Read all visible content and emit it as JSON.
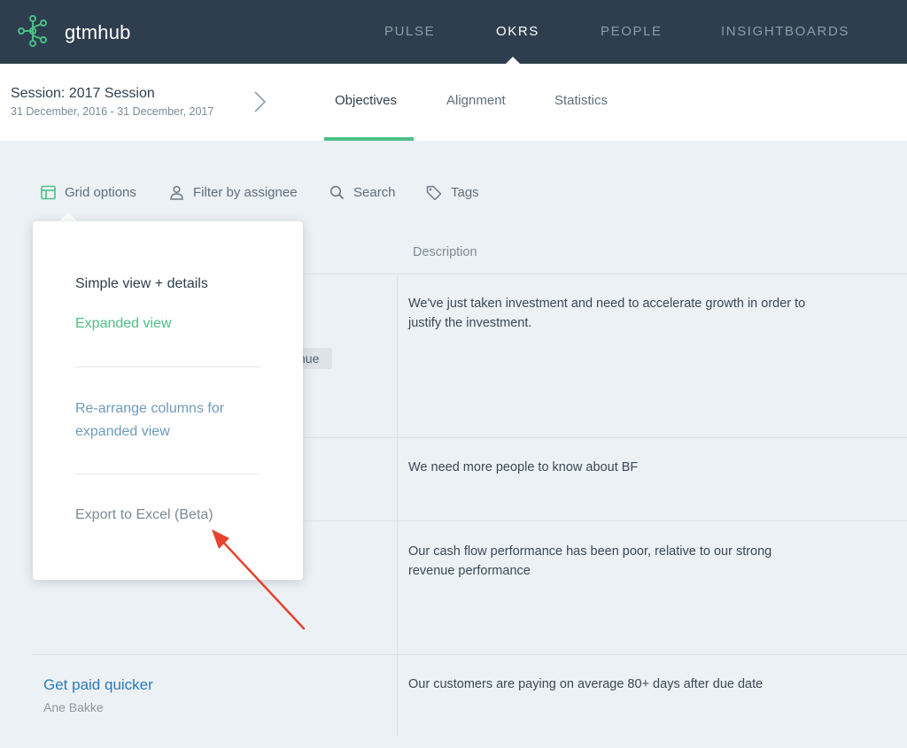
{
  "app": {
    "brand": "gtmhub"
  },
  "nav": {
    "items": [
      {
        "label": "PULSE"
      },
      {
        "label": "OKRS"
      },
      {
        "label": "PEOPLE"
      },
      {
        "label": "INSIGHTBOARDS"
      }
    ],
    "active": "OKRS"
  },
  "session": {
    "title": "Session: 2017 Session",
    "dates": "31 December, 2016 - 31 December, 2017"
  },
  "tabs": {
    "items": [
      {
        "label": "Objectives"
      },
      {
        "label": "Alignment"
      },
      {
        "label": "Statistics"
      }
    ],
    "active": "Objectives"
  },
  "toolbar": {
    "grid_options": "Grid options",
    "filter_by_assignee": "Filter by assignee",
    "search": "Search",
    "tags": "Tags"
  },
  "grid_menu": {
    "simple_view": "Simple view + details",
    "expanded_view": "Expanded view",
    "rearrange_line1": "Re-arrange columns for",
    "rearrange_line2": "expanded view",
    "export": "Export to Excel (Beta)"
  },
  "table": {
    "description_header": "Description",
    "partial_tag": "nue",
    "rows": [
      {
        "desc_line1": "We've just taken investment and need to accelerate growth in order to",
        "desc_line2": "justify the investment."
      },
      {
        "desc_line1": "We need more people to know about BF",
        "desc_line2": ""
      },
      {
        "desc_line1": "Our cash flow performance has been poor, relative to our strong",
        "desc_line2": "revenue performance"
      },
      {
        "title": "Get paid quicker",
        "owner": "Ane Bakke",
        "desc_line1": "Our customers are paying on average 80+ days after due date",
        "desc_line2": ""
      }
    ]
  },
  "colors": {
    "topbar": "#2e3e4e",
    "accent_green": "#4cbf86",
    "link_blue": "#2a7ab8",
    "annotation_red": "#e5432d"
  }
}
